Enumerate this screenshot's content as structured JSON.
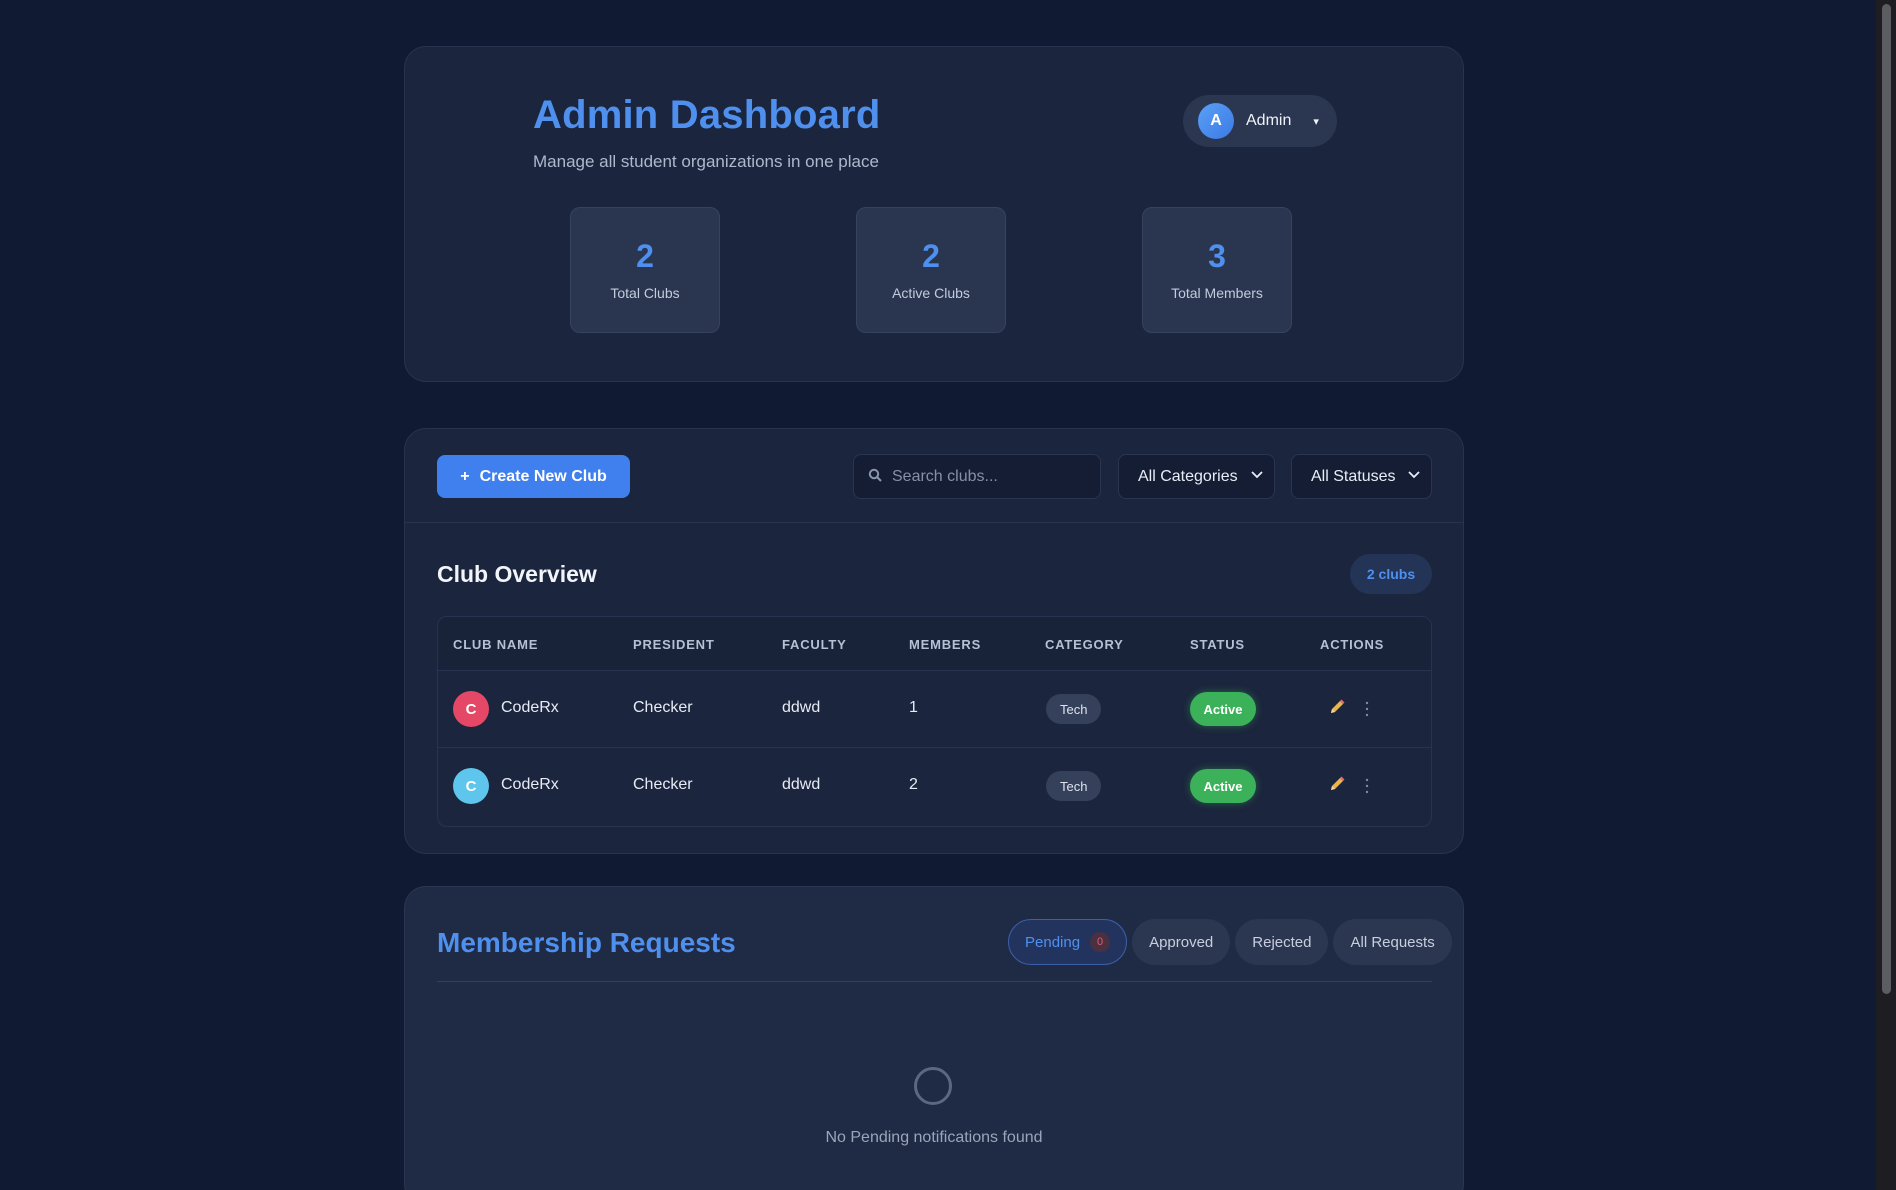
{
  "header": {
    "title": "Admin Dashboard",
    "subtitle": "Manage all student organizations in one place",
    "user": {
      "avatar_letter": "A",
      "name": "Admin",
      "caret": "▾"
    }
  },
  "stats": [
    {
      "value": "2",
      "label": "Total Clubs"
    },
    {
      "value": "2",
      "label": "Active Clubs"
    },
    {
      "value": "3",
      "label": "Total Members"
    }
  ],
  "toolbar": {
    "create_icon": "+",
    "create_label": "Create New Club",
    "search_icon": "search-icon",
    "search_placeholder": "Search clubs...",
    "category_filter": "All Categories",
    "status_filter": "All Statuses"
  },
  "overview": {
    "title": "Club Overview",
    "count_badge": "2 clubs",
    "columns": [
      "CLUB NAME",
      "PRESIDENT",
      "FACULTY",
      "MEMBERS",
      "CATEGORY",
      "STATUS",
      "ACTIONS"
    ],
    "rows": [
      {
        "avatar": "C",
        "avatar_color": "#e54866",
        "name": "CodeRx",
        "president": "Checker",
        "faculty": "ddwd",
        "members": "1",
        "category": "Tech",
        "status": "Active"
      },
      {
        "avatar": "C",
        "avatar_color": "#5ec6ec",
        "name": "CodeRx",
        "president": "Checker",
        "faculty": "ddwd",
        "members": "2",
        "category": "Tech",
        "status": "Active"
      }
    ]
  },
  "membership": {
    "title": "Membership Requests",
    "tabs": [
      {
        "label": "Pending",
        "count": "0"
      },
      {
        "label": "Approved"
      },
      {
        "label": "Rejected"
      },
      {
        "label": "All Requests"
      }
    ],
    "empty_message": "No Pending notifications found"
  },
  "colors": {
    "background": "#111a33",
    "accent": "#4f90ef",
    "card": "#1b253d",
    "active_status": "#3bb25a"
  }
}
